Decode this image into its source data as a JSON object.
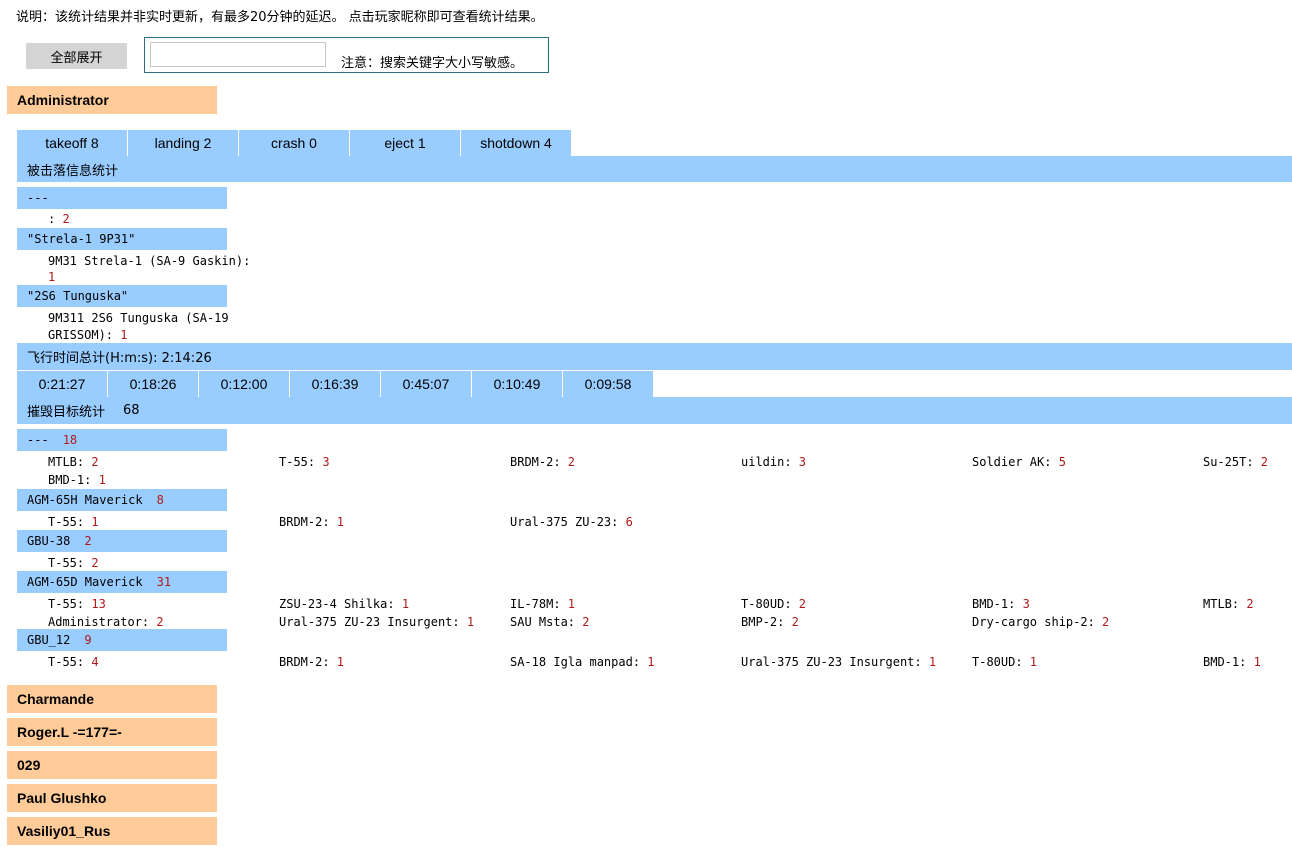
{
  "notice": "说明：该统计结果并非实时更新，有最多20分钟的延迟。 点击玩家昵称即可查看统计结果。",
  "expand_all_label": "全部展开",
  "search": {
    "value": "",
    "placeholder": "",
    "note": "注意：搜索关键字大小写敏感。"
  },
  "players": [
    "Administrator",
    "Charmande",
    "Roger.L -=177=-",
    "029",
    "Paul Glushko",
    "Vasiliy01_Rus"
  ],
  "tabs": [
    {
      "label": "takeoff 8"
    },
    {
      "label": "landing 2"
    },
    {
      "label": "crash 0"
    },
    {
      "label": "eject 1"
    },
    {
      "label": "shotdown 4"
    }
  ],
  "shotdown_title": "被击落信息统计",
  "shotdown_groups": [
    {
      "head": "---",
      "lines": [
        {
          "label": ": ",
          "value": "2"
        }
      ]
    },
    {
      "head": "\"Strela-1 9P31\"",
      "lines": [
        {
          "label": "9M31 Strela-1 (SA-9 Gaskin):",
          "value": "1"
        }
      ]
    },
    {
      "head": "\"2S6 Tunguska\"",
      "lines": [
        {
          "label": "9M311 2S6 Tunguska (SA-19",
          "label2": "GRISSOM): ",
          "value": "1"
        }
      ]
    }
  ],
  "flight_time_title": "飞行时间总计(H:m:s): 2:14:26",
  "flight_times": [
    "0:21:27",
    "0:18:26",
    "0:12:00",
    "0:16:39",
    "0:45:07",
    "0:10:49",
    "0:09:58"
  ],
  "kills_title": "摧毁目标统计",
  "kills_total": "68",
  "kill_groups": [
    {
      "head": "---",
      "count": "18",
      "rows": [
        [
          {
            "n": "MTLB: ",
            "v": "2"
          },
          {
            "n": "T-55: ",
            "v": "3"
          },
          {
            "n": "BRDM-2: ",
            "v": "2"
          },
          {
            "n": "uildin: ",
            "v": "3"
          },
          {
            "n": "Soldier AK: ",
            "v": "5"
          },
          {
            "n": "Su-25T: ",
            "v": "2"
          }
        ],
        [
          {
            "n": "BMD-1: ",
            "v": "1"
          }
        ]
      ]
    },
    {
      "head": "AGM-65H Maverick",
      "count": "8",
      "rows": [
        [
          {
            "n": "T-55: ",
            "v": "1"
          },
          {
            "n": "BRDM-2: ",
            "v": "1"
          },
          {
            "n": "Ural-375 ZU-23: ",
            "v": "6"
          }
        ]
      ]
    },
    {
      "head": "GBU-38",
      "count": "2",
      "rows": [
        [
          {
            "n": "T-55: ",
            "v": "2"
          }
        ]
      ]
    },
    {
      "head": "AGM-65D Maverick",
      "count": "31",
      "rows": [
        [
          {
            "n": "T-55: ",
            "v": "13"
          },
          {
            "n": "ZSU-23-4 Shilka: ",
            "v": "1"
          },
          {
            "n": "IL-78M: ",
            "v": "1"
          },
          {
            "n": "T-80UD: ",
            "v": "2"
          },
          {
            "n": "BMD-1: ",
            "v": "3"
          },
          {
            "n": "MTLB: ",
            "v": "2"
          }
        ],
        [
          {
            "n": "Administrator: ",
            "v": "2"
          },
          {
            "n": "Ural-375 ZU-23 Insurgent: ",
            "v": "1"
          },
          {
            "n": "SAU Msta: ",
            "v": "2"
          },
          {
            "n": "BMP-2: ",
            "v": "2"
          },
          {
            "n": "Dry-cargo ship-2: ",
            "v": "2"
          }
        ]
      ]
    },
    {
      "head": "GBU_12",
      "count": "9",
      "rows": [
        [
          {
            "n": "T-55: ",
            "v": "4"
          },
          {
            "n": "BRDM-2: ",
            "v": "1"
          },
          {
            "n": "SA-18 Igla manpad: ",
            "v": "1"
          },
          {
            "n": "Ural-375 ZU-23 Insurgent: ",
            "v": "1"
          },
          {
            "n": "T-80UD: ",
            "v": "1"
          },
          {
            "n": "BMD-1: ",
            "v": "1"
          }
        ]
      ]
    }
  ],
  "colors": {
    "player_bg": "#ffcc99",
    "section_bg": "#99ccff",
    "number": "#b0191a"
  }
}
